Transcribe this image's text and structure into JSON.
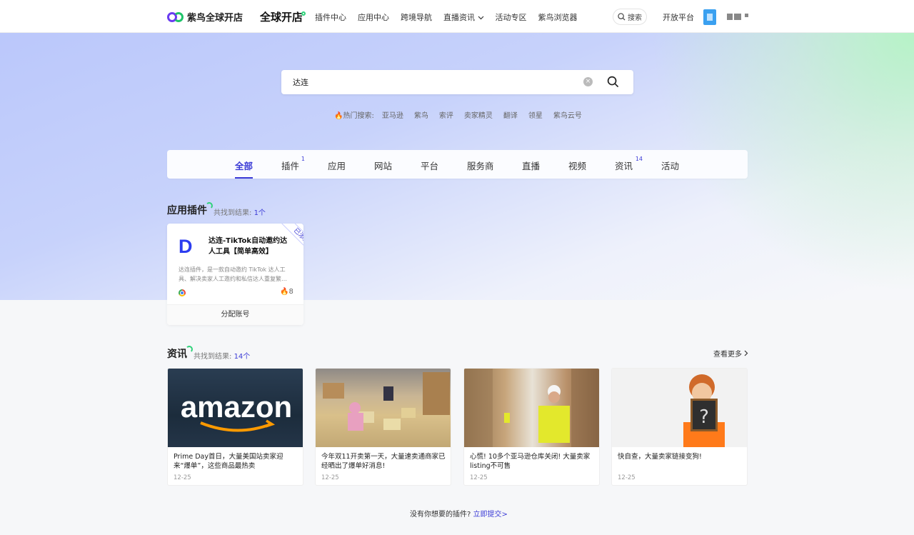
{
  "header": {
    "logo_text": "紫鸟全球开店",
    "brand2": "全球开店",
    "nav": [
      "插件中心",
      "应用中心",
      "跨境导航",
      "直播资讯",
      "活动专区",
      "紫鸟浏览器"
    ],
    "search_label": "搜索",
    "open_platform": "开放平台"
  },
  "search": {
    "value": "达连",
    "hot_label": "热门搜索:",
    "hot": [
      "亚马逊",
      "紫鸟",
      "索评",
      "卖家精灵",
      "翻译",
      "领星",
      "紫鸟云号"
    ]
  },
  "tabs": [
    {
      "label": "全部",
      "badge": ""
    },
    {
      "label": "插件",
      "badge": "1"
    },
    {
      "label": "应用",
      "badge": ""
    },
    {
      "label": "网站",
      "badge": ""
    },
    {
      "label": "平台",
      "badge": ""
    },
    {
      "label": "服务商",
      "badge": ""
    },
    {
      "label": "直播",
      "badge": ""
    },
    {
      "label": "视频",
      "badge": ""
    },
    {
      "label": "资讯",
      "badge": "14"
    },
    {
      "label": "活动",
      "badge": ""
    }
  ],
  "plugins_section": {
    "title": "应用插件",
    "count_prefix": "共找到结果:",
    "count": "1个",
    "card": {
      "logo": "D",
      "name": "达连-TikTok自动邀约达人工具【简单高效】",
      "desc": "达连插件，是一款自动邀约 TikTok 达人工具、解决卖家人工邀约和私信达人重复繁…",
      "ribbon": "已添加",
      "hot_count": "8",
      "assign": "分配账号"
    }
  },
  "news_section": {
    "title": "资讯",
    "count_prefix": "共找到结果:",
    "count": "14个",
    "more": "查看更多",
    "items": [
      {
        "title": "Prime Day首日，大量美国站卖家迎来“爆单”，这些商品最热卖",
        "date": "12-25",
        "image_text": "amazon"
      },
      {
        "title": "今年双11开卖第一天，大量速卖通商家已经晒出了爆单好消息!",
        "date": "12-25"
      },
      {
        "title": "心慌! 10多个亚马逊仓库关闭! 大量卖家listing不可售",
        "date": "12-25"
      },
      {
        "title": "快自查，大量卖家链接变狗!",
        "date": "12-25"
      }
    ]
  },
  "footer": {
    "text": "没有你想要的插件?",
    "link": "立即提交>"
  },
  "colors": {
    "accent": "#3b3bd6",
    "green": "#2fd27a"
  }
}
